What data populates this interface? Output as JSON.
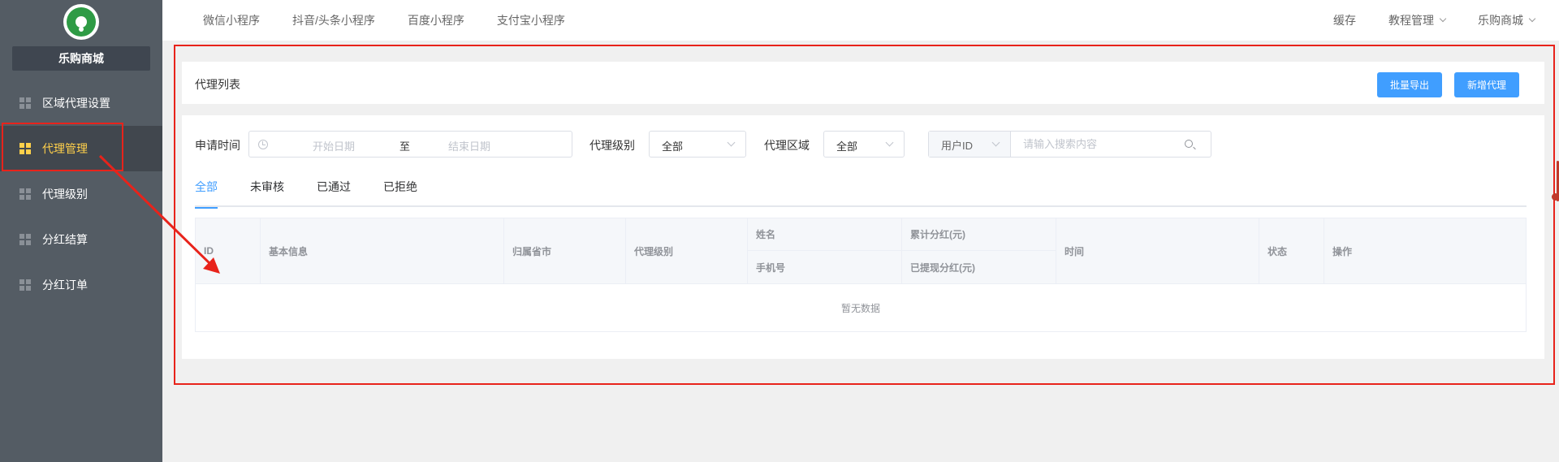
{
  "sidebar": {
    "shop_name": "乐购商城",
    "logo_icon": "leaf-logo-icon",
    "items": [
      {
        "label": "区域代理设置",
        "icon": "grid-icon",
        "active": false
      },
      {
        "label": "代理管理",
        "icon": "grid-icon",
        "active": true
      },
      {
        "label": "代理级别",
        "icon": "grid-icon",
        "active": false
      },
      {
        "label": "分红结算",
        "icon": "grid-icon",
        "active": false
      },
      {
        "label": "分红订单",
        "icon": "grid-icon",
        "active": false
      }
    ]
  },
  "topbar": {
    "nav": [
      "微信小程序",
      "抖音/头条小程序",
      "百度小程序",
      "支付宝小程序"
    ],
    "right": {
      "cache": "缓存",
      "tutorial": "教程管理",
      "shop": "乐购商城"
    }
  },
  "panel": {
    "title": "代理列表",
    "export_label": "批量导出",
    "add_label": "新增代理"
  },
  "filters": {
    "apply_time_label": "申请时间",
    "start_placeholder": "开始日期",
    "range_separator": "至",
    "end_placeholder": "结束日期",
    "level_label": "代理级别",
    "level_value": "全部",
    "region_label": "代理区域",
    "region_value": "全部",
    "search_field": "用户ID",
    "search_placeholder": "请输入搜索内容"
  },
  "tabs": [
    {
      "label": "全部",
      "active": true
    },
    {
      "label": "未审核",
      "active": false
    },
    {
      "label": "已通过",
      "active": false
    },
    {
      "label": "已拒绝",
      "active": false
    }
  ],
  "table": {
    "columns": {
      "id": "ID",
      "basic_info": "基本信息",
      "province_city": "归属省市",
      "agent_level": "代理级别",
      "name": "姓名",
      "phone": "手机号",
      "total_dividend": "累计分红(元)",
      "withdrawn_dividend": "已提现分红(元)",
      "time": "时间",
      "status": "状态",
      "action": "操作"
    },
    "empty_text": "暂无数据"
  },
  "colors": {
    "sidebar_bg": "#545c64",
    "active_menu": "#ffd04b",
    "primary": "#409eff",
    "annotation_red": "#e8231b"
  }
}
